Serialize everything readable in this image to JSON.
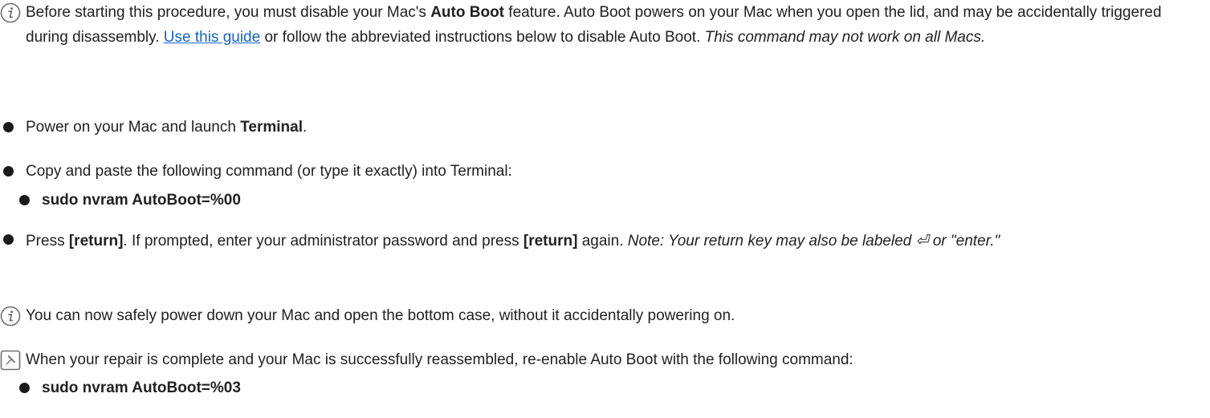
{
  "colors": {
    "text": "#212121",
    "link": "#1466c7",
    "icon": "#6f6f6f"
  },
  "icons": {
    "info": "info-icon",
    "note": "pin-icon"
  },
  "steps": [
    {
      "icon": "info",
      "parts": [
        "Before starting this procedure, you must disable your Mac's ",
        "Auto Boot",
        " feature. Auto Boot powers on your Mac when you open the lid, and may be accidentally triggered during disassembly. ",
        "Use this guide",
        " or follow the abbreviated instructions below to disable Auto Boot. ",
        "This command may not work on all Macs."
      ]
    },
    {
      "icon": "bullet",
      "parts": [
        "Power on your Mac and launch ",
        "Terminal",
        "."
      ]
    },
    {
      "icon": "bullet",
      "parts": [
        "Copy and paste the following command (or type it exactly) into Terminal:"
      ],
      "sub": "sudo nvram AutoBoot=%00"
    },
    {
      "icon": "bullet",
      "parts": [
        "Press ",
        "[return]",
        ". If prompted, enter your administrator password and press ",
        "[return]",
        " again. ",
        "Note: Your return key may also be labeled ⏎ or \"enter.\""
      ]
    },
    {
      "icon": "info",
      "parts": [
        "You can now safely power down your Mac and open the bottom case, without it accidentally powering on."
      ]
    },
    {
      "icon": "note",
      "parts": [
        "When your repair is complete and your Mac is successfully reassembled, re-enable Auto Boot with the following command:"
      ],
      "sub": "sudo nvram AutoBoot=%03"
    }
  ]
}
